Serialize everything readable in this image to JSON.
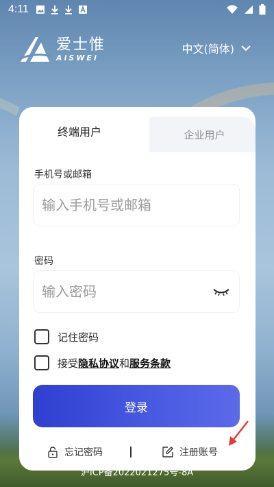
{
  "status_bar": {
    "time": "4:11",
    "left_icons": [
      "image-icon",
      "download-icon",
      "download-icon",
      "a-icon"
    ],
    "right_icons": [
      "wifi-icon",
      "signal-icon",
      "battery-icon"
    ]
  },
  "brand": {
    "name_cn": "爱士惟",
    "name_en": "AiSWEi"
  },
  "language_selector": {
    "value": "中文(简体)",
    "icon": "chevron-down-icon"
  },
  "tabs": [
    {
      "label": "终端用户",
      "active": true
    },
    {
      "label": "企业用户",
      "active": false
    }
  ],
  "form": {
    "account_label": "手机号或邮箱",
    "account_placeholder": "输入手机号或邮箱",
    "account_value": "",
    "password_label": "密码",
    "password_placeholder": "输入密码",
    "password_value": "",
    "remember_label": "记住密码",
    "remember_checked": false,
    "agree_prefix": "接受",
    "agree_privacy": "隐私协议",
    "agree_and": "和",
    "agree_terms": "服务条款",
    "agree_checked": false,
    "login_label": "登录"
  },
  "footer_links": {
    "forgot_label": "忘记密码",
    "register_label": "注册账号",
    "separator": "|"
  },
  "icp": "沪ICP备2022021275号-8A",
  "colors": {
    "login_gradient_start": "#2f3fd0",
    "login_gradient_end": "#5c6ae8",
    "annotation_arrow": "#e53935"
  }
}
